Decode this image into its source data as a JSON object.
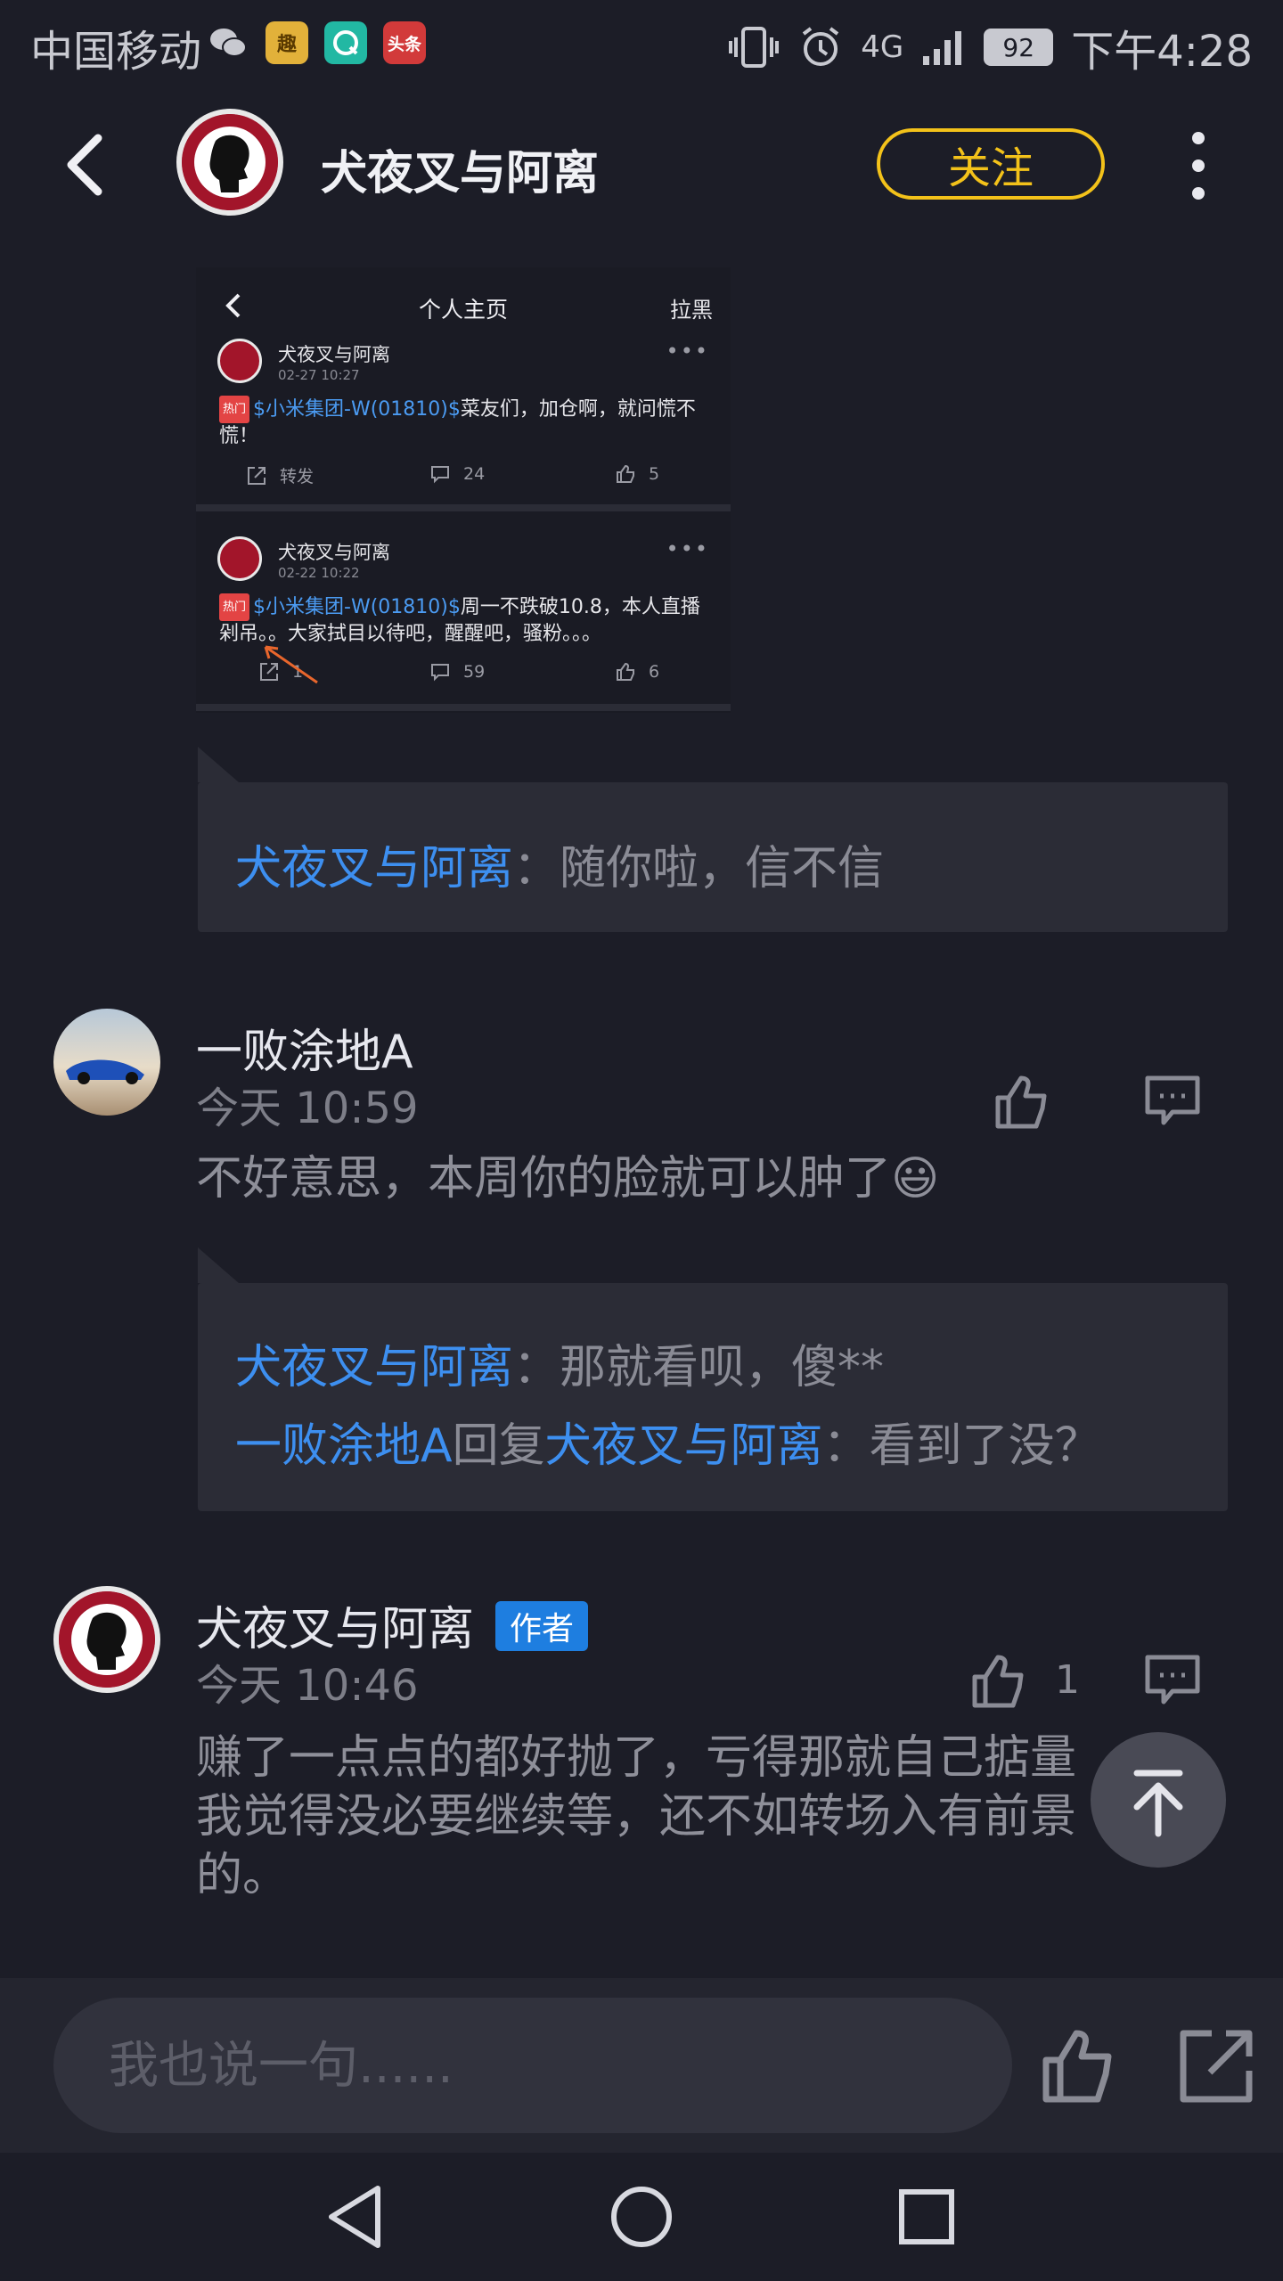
{
  "status_bar": {
    "carrier": "中国移动",
    "app_icons": [
      "wechat-icon",
      "qutoutiao-icon",
      "qq-browser-icon",
      "toutiao-icon"
    ],
    "qu_label": "趣",
    "tt_label": "头条",
    "network": "4G",
    "battery": "92",
    "time": "下午4:28"
  },
  "header": {
    "title": "犬夜叉与阿离",
    "follow_label": "关注"
  },
  "embedded_screenshot": {
    "title": "个人主页",
    "block_label": "拉黑",
    "posts": [
      {
        "user": "犬夜叉与阿离",
        "time": "02-27 10:27",
        "hot_tag": "热门",
        "stock": "$小米集团-W(01810)$",
        "text": "菜友们，加仓啊，就问慌不慌！",
        "share": "转发",
        "comments": "24",
        "likes": "5"
      },
      {
        "user": "犬夜叉与阿离",
        "time": "02-22 10:22",
        "hot_tag": "热门",
        "stock": "$小米集团-W(01810)$",
        "text": "周一不跌破10.8，本人直播剁吊。。大家拭目以待吧，醒醒吧，骚粉。。。",
        "share": "1",
        "comments": "59",
        "likes": "6"
      }
    ]
  },
  "quote1": {
    "author": "犬夜叉与阿离",
    "separator": "：",
    "text": "随你啦，信不信"
  },
  "comment1": {
    "user": "一败涂地A",
    "time": "今天 10:59",
    "text": "不好意思，本周你的脸就可以肿了😃"
  },
  "quote2": {
    "line1_author": "犬夜叉与阿离",
    "line1_sep": "：",
    "line1_text": "那就看呗，傻**",
    "line2_author": "一败涂地A",
    "line2_reply": "回复",
    "line2_target": "犬夜叉与阿离",
    "line2_sep": "：",
    "line2_text": "看到了没？"
  },
  "comment2": {
    "user": "犬夜叉与阿离",
    "badge": "作者",
    "time": "今天 10:46",
    "likes": "1",
    "text_lines": [
      "赚了一点点的都好抛了，亏得那就自己掂量",
      "我觉得没必要继续等，还不如转场入有前景",
      "的。"
    ]
  },
  "bottom_bar": {
    "input_placeholder": "我也说一句......"
  },
  "colors": {
    "background": "#1c1d27",
    "accent_blue": "#3d8ff0",
    "follow_yellow": "#f3c21a",
    "author_badge": "#1e7ee0"
  }
}
